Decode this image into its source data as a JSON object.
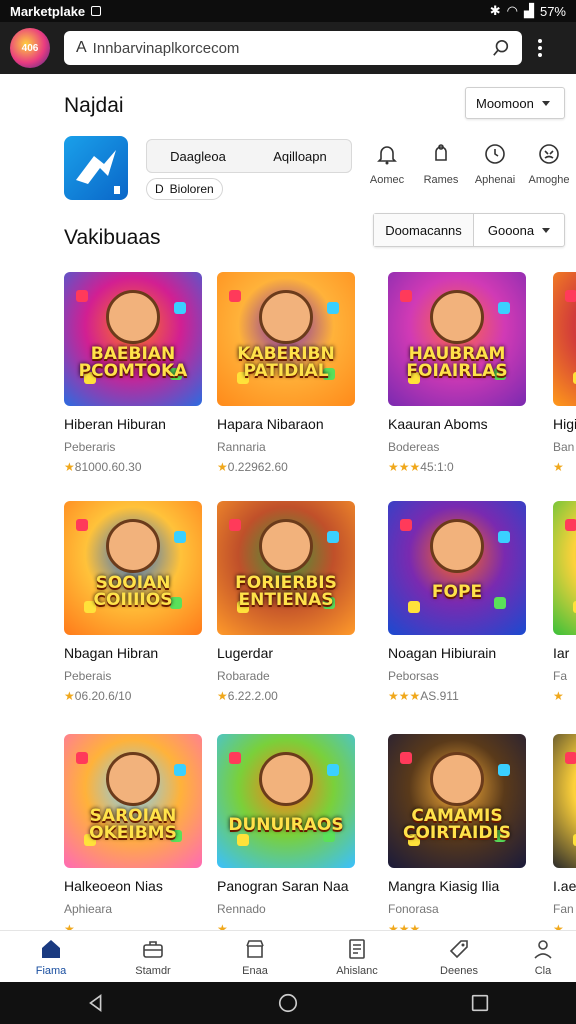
{
  "status_bar": {
    "title": "Marketplake",
    "battery": "57%"
  },
  "browser": {
    "logo_text": "406",
    "url": "Innbarvinaplkorcecom"
  },
  "top_section": {
    "title": "Najdai",
    "sort_label": "Moomoon"
  },
  "featured": {
    "tabs": [
      {
        "label": "Daagleoa"
      },
      {
        "label": "Aqilloapn"
      }
    ],
    "tab_hint": "ᐃ",
    "chip_label": "Bioloren",
    "chip_prefix": "D"
  },
  "categories": [
    {
      "label": "Aomec",
      "icon": "bell-icon"
    },
    {
      "label": "Rames",
      "icon": "bell-alt-icon"
    },
    {
      "label": "Aphenai",
      "icon": "clock-icon"
    },
    {
      "label": "Amoghe",
      "icon": "face-icon"
    }
  ],
  "games_section": {
    "title": "Vakibuaas",
    "seg_left": "Doomacanns",
    "seg_right": "Gooona"
  },
  "games": [
    {
      "name": "Hiberan Hiburan",
      "sub": "Peberaris",
      "stars": "★",
      "rating": "81000.60.30",
      "art": "BAEBIAN PCOMTOKA",
      "colors": [
        "#2b6ce0",
        "#d21f92",
        "#ff7a1a"
      ]
    },
    {
      "name": "Hapara Nibaraon",
      "sub": "Rannaria",
      "stars": "★",
      "rating": "0.22962.60",
      "art": "KABERIBN PATIDIAL",
      "colors": [
        "#ff8a1a",
        "#ffb23a",
        "#7a2ab0"
      ]
    },
    {
      "name": "Kaauran Aboms",
      "sub": "Bodereas",
      "stars": "★★★",
      "rating": "45:1:0",
      "art": "HAUBRAM FOIAIRLAS",
      "colors": [
        "#7a2ab0",
        "#d13ab5",
        "#ff6a3d"
      ]
    },
    {
      "name": "Higi",
      "sub": "Ban",
      "stars": "★",
      "rating": "",
      "art": "",
      "colors": [
        "#ff9a1a",
        "#d13a3a",
        "#ffc83d"
      ]
    },
    {
      "name": "Nbagan Hibran",
      "sub": "Peberais",
      "stars": "★",
      "rating": "06.20.6/10",
      "art": "SOOIAN COIIIIOS",
      "colors": [
        "#ff7a1a",
        "#ffc23a",
        "#2a6cd0"
      ]
    },
    {
      "name": "Lugerdar",
      "sub": "Robarade",
      "stars": "★",
      "rating": "6.22.2.00",
      "art": "FORIERBIS ENTIENAS",
      "colors": [
        "#ff9a2a",
        "#c0502a",
        "#3a9a3a"
      ]
    },
    {
      "name": "Noagan Hibiurain",
      "sub": "Peborsas",
      "stars": "★★★",
      "rating": "AS.911",
      "art": "FOPE",
      "colors": [
        "#1a4ad0",
        "#7a2ab0",
        "#ff6a1a"
      ]
    },
    {
      "name": "Iar",
      "sub": "Fa",
      "stars": "★",
      "rating": "",
      "art": "",
      "colors": [
        "#3ac03a",
        "#ffd23a",
        "#1a8a3a"
      ]
    },
    {
      "name": "Halkeoeon Nias",
      "sub": "Aphieara",
      "stars": "★",
      "rating": "",
      "art": "SAROIAN OKEIBMS",
      "colors": [
        "#ff6ab5",
        "#ffb23a",
        "#7ad0ff"
      ]
    },
    {
      "name": "Panogran Saran Naa",
      "sub": "Rennado",
      "stars": "★",
      "rating": "",
      "art": "DUNUIRAOS",
      "colors": [
        "#3ac0ff",
        "#7ad03a",
        "#ff7a1a"
      ]
    },
    {
      "name": "Mangra Kiasig Ilia",
      "sub": "Fonorasa",
      "stars": "★★★",
      "rating": "",
      "art": "CAMAMIS COIRTAIDIS",
      "colors": [
        "#1a1a3a",
        "#5a3a1a",
        "#ffb23a"
      ]
    },
    {
      "name": "I.ae",
      "sub": "Fan",
      "stars": "★",
      "rating": "",
      "art": "",
      "colors": [
        "#2a2a2a",
        "#ffd23a",
        "#c0402a"
      ]
    }
  ],
  "bottom_nav": [
    {
      "label": "Fiama",
      "icon": "home-icon",
      "active": true
    },
    {
      "label": "Stamdr",
      "icon": "briefcase-icon",
      "active": false
    },
    {
      "label": "Enaa",
      "icon": "store-icon",
      "active": false
    },
    {
      "label": "Ahislanc",
      "icon": "document-icon",
      "active": false
    },
    {
      "label": "Deenes",
      "icon": "tag-icon",
      "active": false
    },
    {
      "label": "Cla",
      "icon": "person-icon",
      "active": false
    }
  ]
}
